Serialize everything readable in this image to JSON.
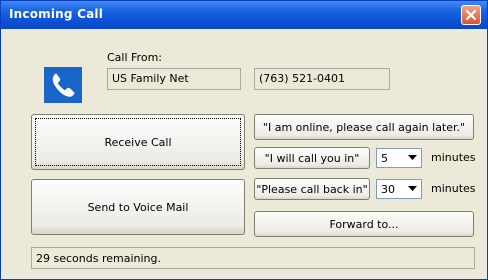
{
  "window": {
    "title": "Incoming Call"
  },
  "caller": {
    "label": "Call From:",
    "name": "US Family Net",
    "number": "(763) 521-0401"
  },
  "buttons": {
    "receive_call": "Receive Call",
    "send_to_voicemail": "Send to Voice Mail",
    "online_msg": "\"I am online, please call again later.\"",
    "will_call_you": "\"I will call you in\"",
    "please_call_back": "\"Please call back in\"",
    "forward_to": "Forward to..."
  },
  "selects": {
    "will_call_minutes": "5",
    "call_back_minutes": "30",
    "unit_label": "minutes"
  },
  "status": {
    "text": "29 seconds remaining."
  },
  "icons": {
    "phone": "phone-handset-icon",
    "close": "close-icon",
    "dropdown": "chevron-down-icon"
  },
  "colors": {
    "titlebar": "#0a52d6",
    "close_button": "#d9562e",
    "phone_icon_bg": "#1a66c8",
    "window_bg": "#ece9d8"
  }
}
